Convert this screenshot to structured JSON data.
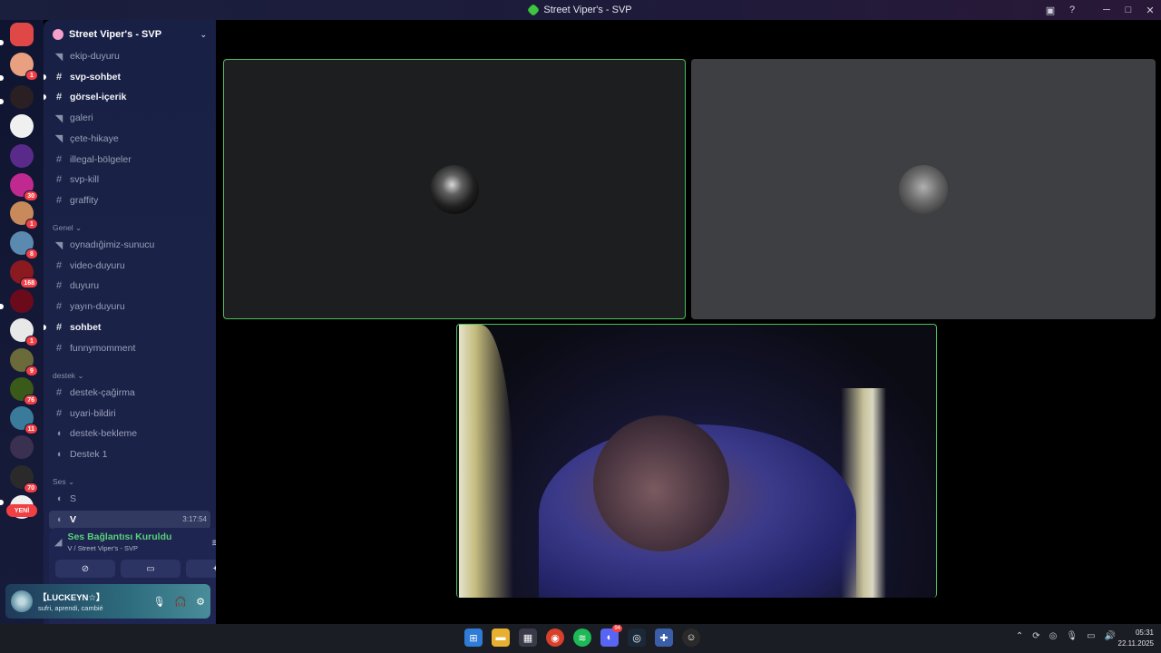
{
  "window": {
    "title": "Street Viper's - SVP",
    "controls": [
      "cast-icon",
      "help-icon",
      "minimize-icon",
      "maximize-icon",
      "close-icon"
    ]
  },
  "rail": {
    "new_label": "YENİ",
    "servers": [
      {
        "name": "discord-home",
        "color": "#e04848",
        "badge": ""
      },
      {
        "name": "server-avatar-1",
        "color": "#e8a080",
        "badge": "1"
      },
      {
        "name": "server-avatar-2",
        "color": "#2a1f22",
        "badge": ""
      },
      {
        "name": "server-avatar-3",
        "color": "#f0f0f0",
        "badge": ""
      },
      {
        "name": "server-avatar-4",
        "color": "#5a2a8a",
        "badge": ""
      },
      {
        "name": "server-avatar-5",
        "color": "#c02a90",
        "badge": "30"
      },
      {
        "name": "server-avatar-6",
        "color": "#c88a5a",
        "badge": "1"
      },
      {
        "name": "server-avatar-7",
        "color": "#5a8ab0",
        "badge": "8"
      },
      {
        "name": "server-avatar-8",
        "color": "#8a1a20",
        "badge": "168"
      },
      {
        "name": "server-avatar-9",
        "color": "#6a0a1a",
        "badge": ""
      },
      {
        "name": "server-avatar-10",
        "color": "#e8e8e8",
        "badge": "1"
      },
      {
        "name": "server-avatar-11",
        "color": "#6a6a3a",
        "badge": "9"
      },
      {
        "name": "server-avatar-12",
        "color": "#3a5a1a",
        "badge": "76"
      },
      {
        "name": "server-avatar-13",
        "color": "#3a7a9a",
        "badge": "11"
      },
      {
        "name": "server-avatar-14",
        "color": "#3a3050",
        "badge": ""
      },
      {
        "name": "server-avatar-15",
        "color": "#2a2a2a",
        "badge": "70"
      },
      {
        "name": "server-avatar-16",
        "color": "#f0f0f0",
        "badge": ""
      }
    ]
  },
  "sidebar": {
    "server_name": "Street Viper's - SVP",
    "channels": [
      {
        "name": "ekip-duyuru",
        "icon": "megaphone",
        "state": ""
      },
      {
        "name": "svp-sohbet",
        "icon": "hash",
        "state": "unread"
      },
      {
        "name": "görsel-içerik",
        "icon": "hash",
        "state": "unread"
      },
      {
        "name": "galeri",
        "icon": "megaphone",
        "state": ""
      },
      {
        "name": "çete-hikaye",
        "icon": "megaphone",
        "state": ""
      },
      {
        "name": "illegal-bölgeler",
        "icon": "hash",
        "state": ""
      },
      {
        "name": "svp-kill",
        "icon": "hash",
        "state": ""
      },
      {
        "name": "graffity",
        "icon": "hash",
        "state": ""
      }
    ],
    "category_genel": "Genel",
    "channels_genel": [
      {
        "name": "oynadığimiz-sunucu",
        "icon": "megaphone",
        "state": ""
      },
      {
        "name": "video-duyuru",
        "icon": "hash",
        "state": ""
      },
      {
        "name": "duyuru",
        "icon": "hash",
        "state": ""
      },
      {
        "name": "yayın-duyuru",
        "icon": "hash",
        "state": ""
      },
      {
        "name": "sohbet",
        "icon": "hash",
        "state": "unread"
      },
      {
        "name": "funnymomment",
        "icon": "hash",
        "state": ""
      }
    ],
    "category_destek": "destek",
    "channels_destek": [
      {
        "name": "destek-çağirma",
        "icon": "hash",
        "state": ""
      },
      {
        "name": "uyari-bildiri",
        "icon": "hash",
        "state": ""
      },
      {
        "name": "destek-bekleme",
        "icon": "speaker",
        "state": ""
      },
      {
        "name": "Destek 1",
        "icon": "speaker",
        "state": ""
      }
    ],
    "category_ses": "Ses",
    "channels_ses": [
      {
        "name": "S",
        "icon": "speaker",
        "state": ""
      },
      {
        "name": "V",
        "icon": "speaker",
        "state": "active",
        "timer": "3:17:54"
      }
    ]
  },
  "voice": {
    "title": "Ses Bağlantısı Kuruldu",
    "subtitle": "V / Street Viper's - SVP"
  },
  "user": {
    "name": "【LUCKEYN☆】",
    "status": "sufri, aprendi, cambié"
  },
  "taskbar": {
    "time": "05:31",
    "date": "22.11.2025",
    "discord_badge": "94"
  }
}
